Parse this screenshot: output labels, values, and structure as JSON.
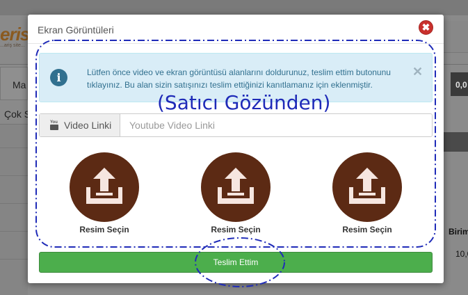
{
  "background": {
    "logo_text": "eris",
    "logo_sub": "...ariş site...",
    "left_tab_label": "Ma",
    "left_cok_label": "Çok S",
    "right_dark_value": "0,0",
    "birim_label": "Birim",
    "birim_value": "10,0"
  },
  "modal": {
    "title": "Ekran Görüntüleri",
    "close_symbol": "✖",
    "alert": {
      "icon_glyph": "i",
      "text": "Lütfen önce video ve ekran görüntüsü alanlarını doldurunuz, teslim ettim butonunu tıklayınız. Bu alan sizin satışınızı teslim ettiğinizi kanıtlamanız için eklenmiştir.",
      "close_symbol": "✕"
    },
    "video": {
      "addon_label": "Video Linki",
      "icon_top": "You",
      "placeholder": "Youtube Video Linki",
      "value": ""
    },
    "uploads": [
      {
        "label": "Resim Seçin"
      },
      {
        "label": "Resim Seçin"
      },
      {
        "label": "Resim Seçin"
      }
    ],
    "submit_label": "Teslim Ettim"
  },
  "annotation": {
    "text": "(Satıcı Gözünden)",
    "color": "#1f2bb8"
  },
  "colors": {
    "upload_circle": "#5c2a14",
    "submit_green": "#4cae4c",
    "alert_bg": "#d9edf7",
    "close_red": "#c9302c"
  }
}
